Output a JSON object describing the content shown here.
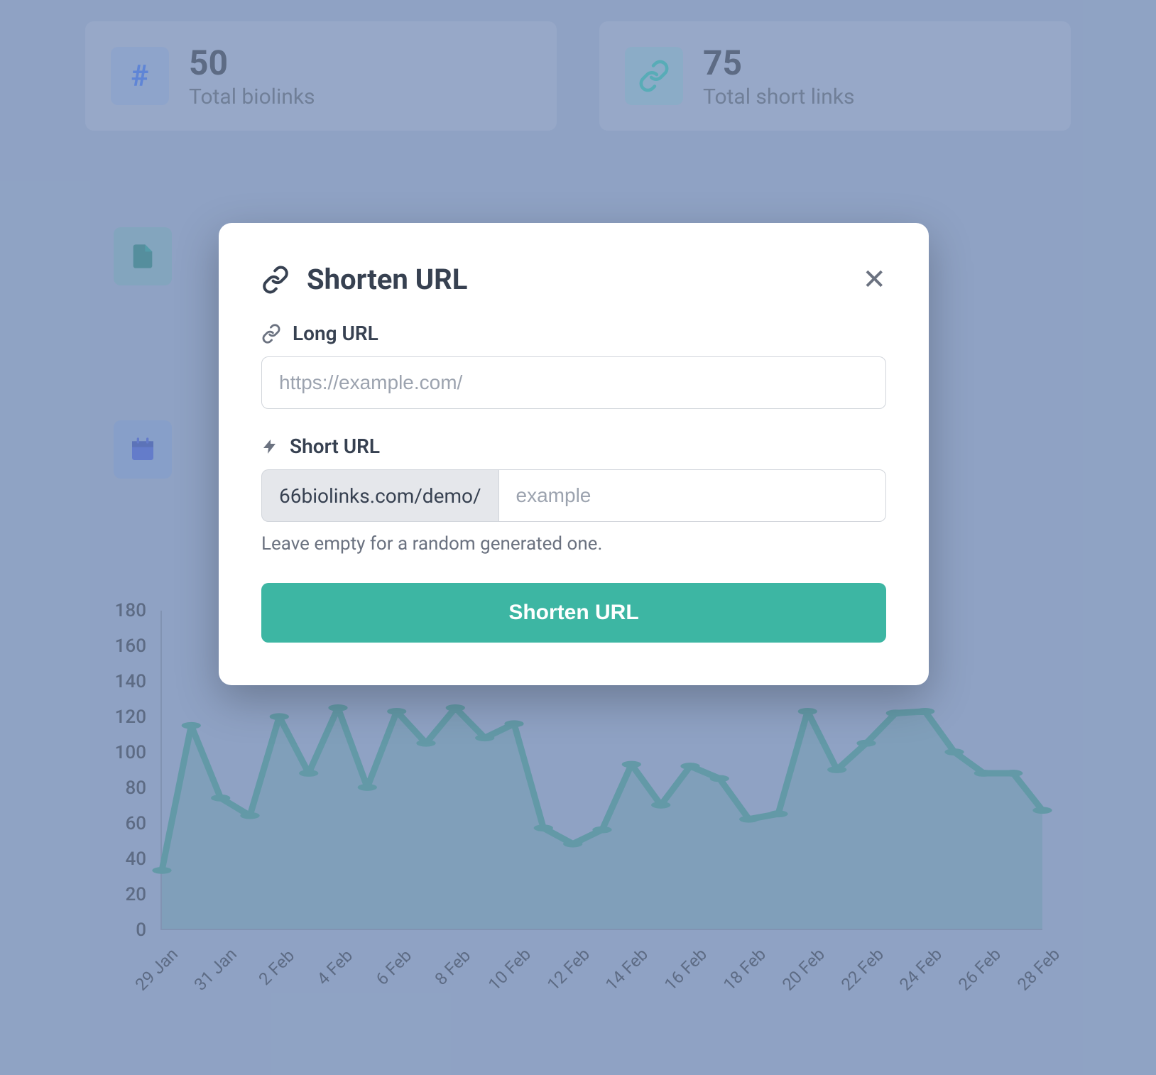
{
  "stats": {
    "biolinks": {
      "value": "50",
      "label": "Total biolinks"
    },
    "shortlinks": {
      "value": "75",
      "label": "Total short links"
    }
  },
  "modal": {
    "title": "Shorten URL",
    "long_url_label": "Long URL",
    "long_url_placeholder": "https://example.com/",
    "short_url_label": "Short URL",
    "short_url_prefix": "66biolinks.com/demo/",
    "short_url_placeholder": "example",
    "help_text": "Leave empty for a random generated one.",
    "submit_label": "Shorten URL"
  },
  "colors": {
    "accent": "#3db6a3",
    "chart_stroke": "#2d8f84",
    "chart_fill": "rgba(45,143,132,0.35)"
  },
  "chart_data": {
    "type": "area",
    "title": "",
    "xlabel": "",
    "ylabel": "",
    "ylim": [
      0,
      180
    ],
    "y_ticks": [
      0,
      20,
      40,
      60,
      80,
      100,
      120,
      140,
      160,
      180
    ],
    "categories": [
      "29 Jan",
      "30 Jan",
      "31 Jan",
      "1 Feb",
      "2 Feb",
      "3 Feb",
      "4 Feb",
      "5 Feb",
      "6 Feb",
      "7 Feb",
      "8 Feb",
      "9 Feb",
      "10 Feb",
      "11 Feb",
      "12 Feb",
      "13 Feb",
      "14 Feb",
      "15 Feb",
      "16 Feb",
      "17 Feb",
      "18 Feb",
      "19 Feb",
      "20 Feb",
      "21 Feb",
      "22 Feb",
      "23 Feb",
      "24 Feb",
      "25 Feb",
      "26 Feb",
      "27 Feb",
      "28 Feb"
    ],
    "x_tick_labels": [
      "29 Jan",
      "31 Jan",
      "2 Feb",
      "4 Feb",
      "6 Feb",
      "8 Feb",
      "10 Feb",
      "12 Feb",
      "14 Feb",
      "16 Feb",
      "18 Feb",
      "20 Feb",
      "22 Feb",
      "24 Feb",
      "26 Feb",
      "28 Feb"
    ],
    "values": [
      33,
      115,
      74,
      64,
      120,
      88,
      125,
      80,
      123,
      105,
      125,
      108,
      116,
      57,
      48,
      56,
      93,
      70,
      92,
      85,
      62,
      65,
      123,
      90,
      105,
      122,
      123,
      100,
      88,
      88,
      67
    ]
  }
}
